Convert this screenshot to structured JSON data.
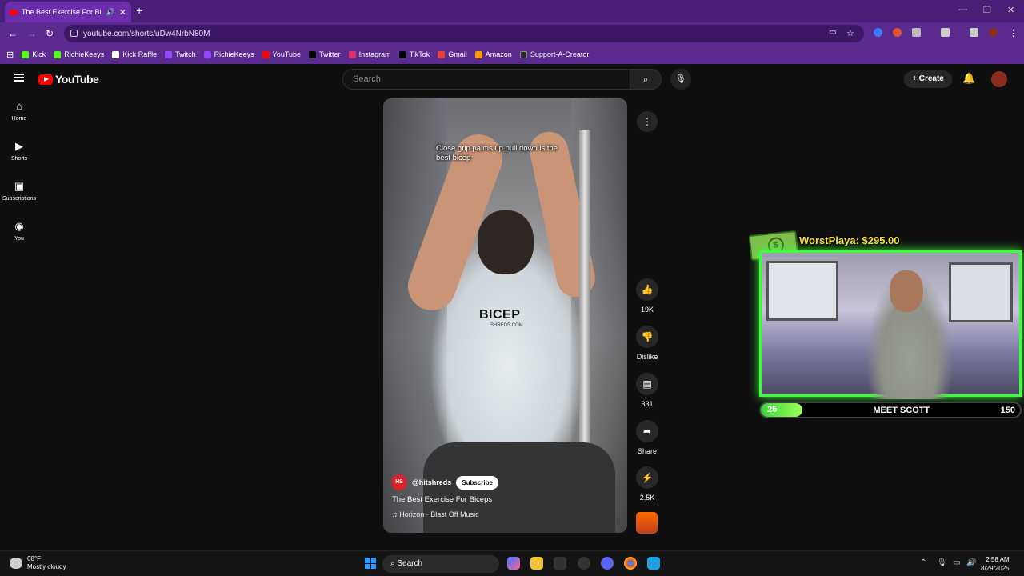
{
  "browser": {
    "tab_title": "The Best Exercise For Biceps",
    "url": "youtube.com/shorts/uDw4NrbN80M",
    "bookmarks": [
      {
        "label": "Kick",
        "color": "#53fc18"
      },
      {
        "label": "RichieKeeys",
        "color": "#53fc18"
      },
      {
        "label": "Kick Raffle",
        "color": "#ffffff"
      },
      {
        "label": "Twitch",
        "color": "#9146ff"
      },
      {
        "label": "RichieKeeys",
        "color": "#9146ff"
      },
      {
        "label": "YouTube",
        "color": "#ff0000"
      },
      {
        "label": "Twitter",
        "color": "#000000"
      },
      {
        "label": "Instagram",
        "color": "#e1306c"
      },
      {
        "label": "TikTok",
        "color": "#000000"
      },
      {
        "label": "Gmail",
        "color": "#ea4335"
      },
      {
        "label": "Amazon",
        "color": "#ff9900"
      },
      {
        "label": "Support-A-Creator",
        "color": "#2b2b2b"
      }
    ]
  },
  "youtube": {
    "logo_text": "YouTube",
    "search_placeholder": "Search",
    "create_label": "Create",
    "sidebar": [
      {
        "label": "Home",
        "icon": "home-icon"
      },
      {
        "label": "Shorts",
        "icon": "shorts-icon"
      },
      {
        "label": "Subscriptions",
        "icon": "subscriptions-icon"
      },
      {
        "label": "You",
        "icon": "you-icon"
      }
    ],
    "short": {
      "caption": "Close grip palms up pull down is the best bicep",
      "shirt_text": "BICEP",
      "shirt_sub": "SHREDS.COM",
      "channel": "@hitshreds",
      "channel_initials": "HS",
      "subscribe_label": "Subscribe",
      "title": "The Best Exercise For Biceps",
      "music": "Horizon · Blast Off Music"
    },
    "actions": {
      "likes": "19K",
      "dislike_label": "Dislike",
      "comments": "331",
      "share_label": "Share",
      "remix": "2.5K"
    }
  },
  "overlay": {
    "donation": "WorstPlaya: $295.00",
    "goal_current": "25",
    "goal_label": "MEET SCOTT",
    "goal_target": "150",
    "accent": "#3aff3a"
  },
  "taskbar": {
    "temp": "68°F",
    "weather": "Mostly cloudy",
    "search_label": "Search",
    "time": "2:58 AM",
    "date": "8/29/2025"
  }
}
